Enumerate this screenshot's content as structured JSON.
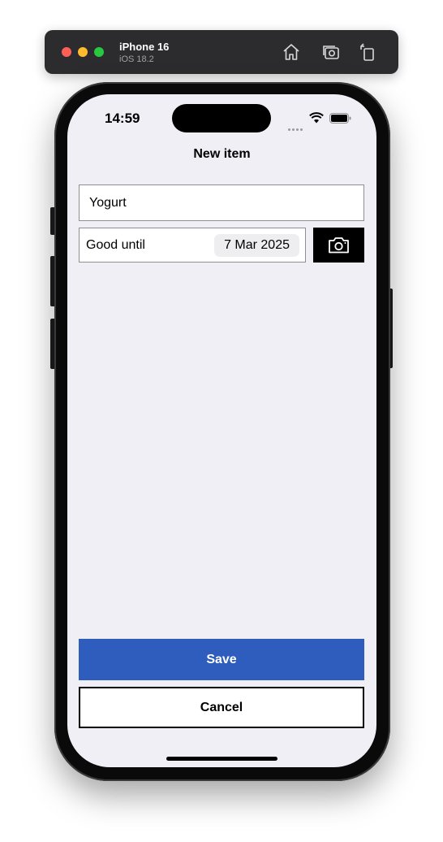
{
  "simulator": {
    "device_name": "iPhone 16",
    "os_version": "iOS 18.2",
    "icons": [
      "home-icon",
      "screenshot-icon",
      "rotate-icon"
    ]
  },
  "status_bar": {
    "time": "14:59",
    "icons": [
      "cellular-signal-icon",
      "wifi-icon",
      "battery-icon"
    ]
  },
  "nav": {
    "title": "New item"
  },
  "form": {
    "name_value": "Yogurt",
    "date_label": "Good until",
    "date_value": "7 Mar 2025",
    "camera_icon": "camera-icon"
  },
  "actions": {
    "save_label": "Save",
    "cancel_label": "Cancel"
  },
  "colors": {
    "accent": "#2e5dbd",
    "background": "#f0eff5",
    "camera_button": "#000000"
  }
}
